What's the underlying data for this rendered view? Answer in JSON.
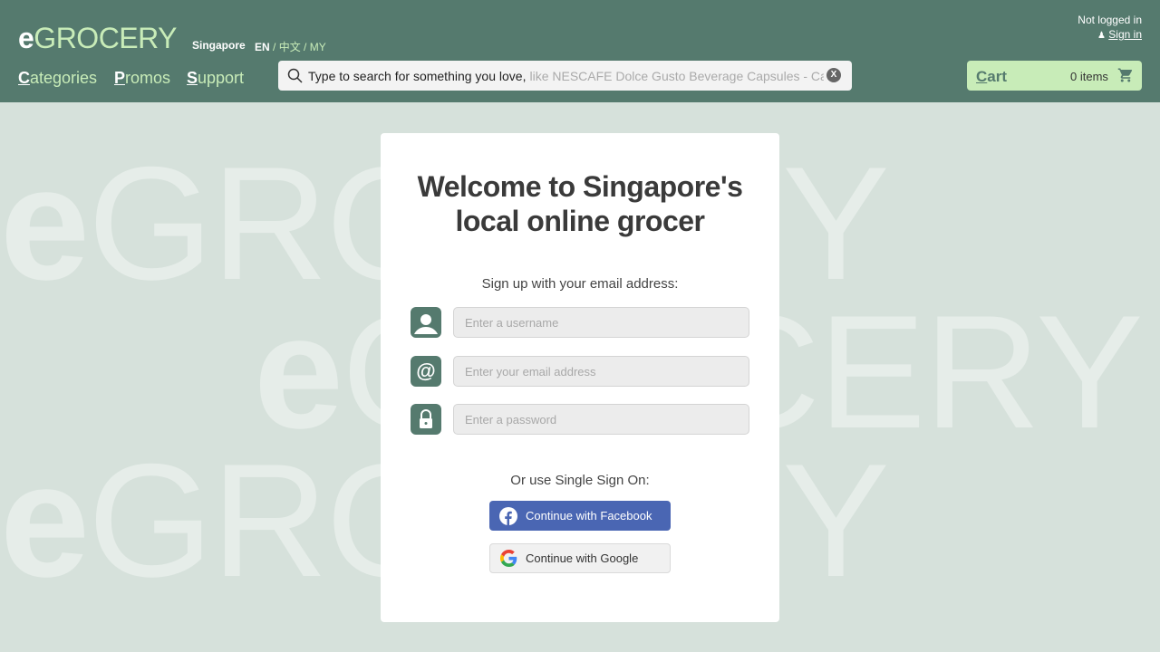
{
  "header": {
    "logo_e": "e",
    "logo_rest": "GROCERY",
    "region": "Singapore",
    "languages": {
      "current": "EN",
      "sep1": " / ",
      "zh": "中文",
      "sep2": " / ",
      "my": "MY"
    },
    "nav": [
      {
        "first": "C",
        "rest": "ategories"
      },
      {
        "first": "P",
        "rest": "romos"
      },
      {
        "first": "S",
        "rest": "upport"
      }
    ],
    "search": {
      "typed": "Type to search for something you love,",
      "hint": "like NESCAFE Dolce Gusto Beverage Capsules - Cafe",
      "clear": "X"
    },
    "login_status": "Not logged in",
    "sign_in": "Sign in",
    "cart": {
      "first": "C",
      "rest": "art",
      "count": "0 items"
    }
  },
  "watermark": {
    "e": "e",
    "text": "GROCERY"
  },
  "card": {
    "title_line1": "Welcome to Singapore's",
    "title_line2": "local online grocer",
    "signup_prompt": "Sign up with your email address:",
    "username_placeholder": "Enter a username",
    "email_placeholder": "Enter your email address",
    "password_placeholder": "Enter a password",
    "sso_prompt": "Or use Single Sign On:",
    "facebook_label": "Continue with Facebook",
    "google_label": "Continue with Google"
  },
  "colors": {
    "brand": "#557a6e",
    "accent": "#c8ecb8",
    "facebook": "#4a66b3"
  }
}
